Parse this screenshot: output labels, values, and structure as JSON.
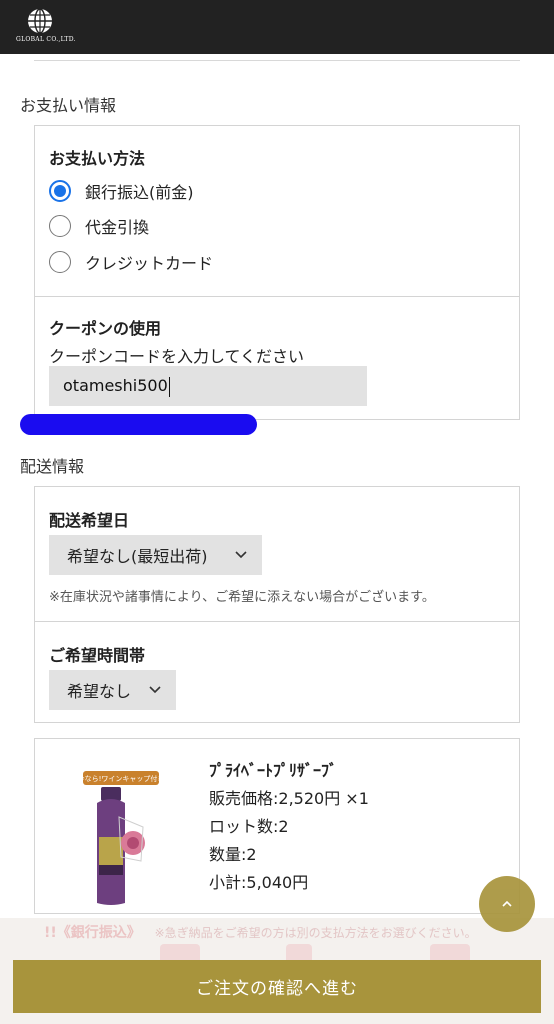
{
  "header": {
    "logo_text": "GLOBAL CO.,LTD."
  },
  "payment": {
    "section_title": "お支払い情報",
    "method_label": "お支払い方法",
    "options": [
      {
        "label": "銀行振込(前金)",
        "checked": true
      },
      {
        "label": "代金引換",
        "checked": false
      },
      {
        "label": "クレジットカード",
        "checked": false
      }
    ],
    "coupon_label": "クーポンの使用",
    "coupon_prompt": "クーポンコードを入力してください",
    "coupon_value": "otameshi500"
  },
  "shipping": {
    "section_title": "配送情報",
    "date_label": "配送希望日",
    "date_selected": "希望なし(最短出荷)",
    "date_note": "※在庫状況や諸事情により、ご希望に添えない場合がございます。",
    "time_label": "ご希望時間帯",
    "time_selected": "希望なし"
  },
  "product": {
    "name": "ﾌﾟﾗｲﾍﾞｰﾄﾌﾟﾘｻﾞｰﾌﾞ",
    "price_line": "販売価格:2,520円 ×1",
    "lot_line": "ロット数:2",
    "qty_line": "数量:2",
    "subtotal_line": "小計:5,040円",
    "image_badge": "今なら!ワインキャップ付き"
  },
  "banner": {
    "highlight": "!!《銀行振込》",
    "text": "※急ぎ納品をご希望の方は別の支払方法をお選びください。"
  },
  "footer": {
    "confirm_label": "ご注文の確認へ進む"
  },
  "colors": {
    "accent_gold": "#a8943c",
    "radio_blue": "#1a73e8",
    "highlight_blue": "#1a0cf0",
    "header_bg": "#222222"
  }
}
